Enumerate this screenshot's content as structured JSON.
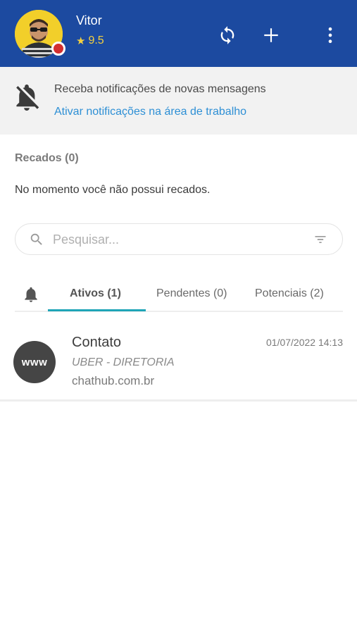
{
  "header": {
    "user_name": "Vitor",
    "rating": "9.5",
    "background_color": "#1c4aa0",
    "status_color": "#d32f2f",
    "icons": [
      "sync-icon",
      "plus-icon",
      "more-vertical-icon"
    ]
  },
  "notification": {
    "title": "Receba notificações de novas mensagens",
    "link": "Ativar notificações na área de trabalho",
    "icon": "bell-off-icon"
  },
  "recados": {
    "title": "Recados (0)",
    "empty_message": "No momento você não possui recados."
  },
  "search": {
    "placeholder": "Pesquisar...",
    "icon": "search-icon",
    "filter_icon": "filter-icon"
  },
  "tabs": [
    {
      "label": "Ativos (1)",
      "active": true
    },
    {
      "label": "Pendentes (0)",
      "active": false
    },
    {
      "label": "Potenciais (2)",
      "active": false
    }
  ],
  "tab_accent_color": "#1fa5b7",
  "chats": [
    {
      "avatar_text": "www",
      "name": "Contato",
      "subtitle": "UBER - DIRETORIA",
      "source": "chathub.com.br",
      "datetime": "01/07/2022 14:13"
    }
  ]
}
